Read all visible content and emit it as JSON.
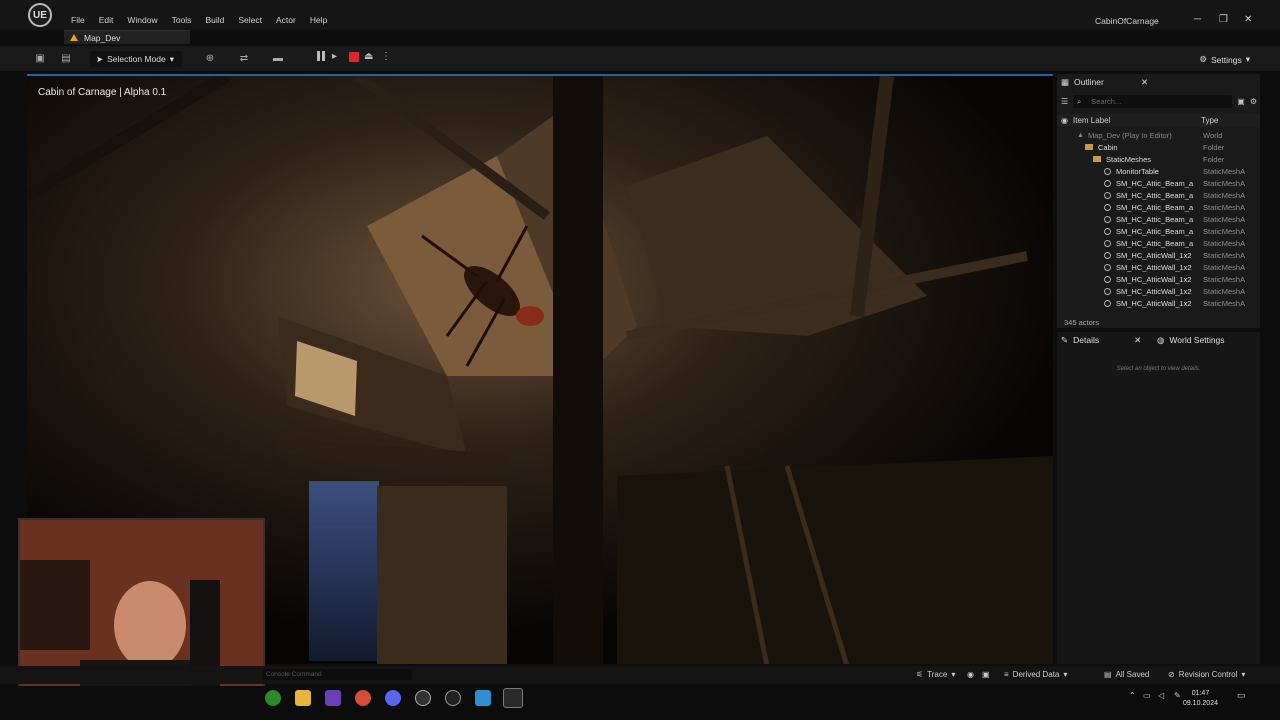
{
  "app": {
    "logo": "UE",
    "menu": [
      "File",
      "Edit",
      "Window",
      "Tools",
      "Build",
      "Select",
      "Actor",
      "Help"
    ],
    "level_tab": "Map_Dev",
    "project_title": "CabinOfCarnage"
  },
  "toolbar": {
    "selection_mode": "Selection Mode",
    "settings": "Settings"
  },
  "viewport": {
    "overlay_text": "Cabin of Carnage | Alpha 0.1"
  },
  "outliner": {
    "tab": "Outliner",
    "search_placeholder": "Search...",
    "col_label": "Item Label",
    "col_type": "Type",
    "rows": [
      {
        "label": "Map_Dev (Play In Editor)",
        "type": "World",
        "kind": "world"
      },
      {
        "label": "Cabin",
        "type": "Folder",
        "kind": "folder"
      },
      {
        "label": "StaticMeshes",
        "type": "Folder",
        "kind": "folder"
      },
      {
        "label": "MonitorTable",
        "type": "StaticMeshA",
        "kind": "mesh"
      },
      {
        "label": "SM_HC_Attic_Beam_a",
        "type": "StaticMeshA",
        "kind": "mesh"
      },
      {
        "label": "SM_HC_Attic_Beam_a",
        "type": "StaticMeshA",
        "kind": "mesh"
      },
      {
        "label": "SM_HC_Attic_Beam_a",
        "type": "StaticMeshA",
        "kind": "mesh"
      },
      {
        "label": "SM_HC_Attic_Beam_a",
        "type": "StaticMeshA",
        "kind": "mesh"
      },
      {
        "label": "SM_HC_Attic_Beam_a",
        "type": "StaticMeshA",
        "kind": "mesh"
      },
      {
        "label": "SM_HC_Attic_Beam_a",
        "type": "StaticMeshA",
        "kind": "mesh"
      },
      {
        "label": "SM_HC_AtticWall_1x2",
        "type": "StaticMeshA",
        "kind": "mesh"
      },
      {
        "label": "SM_HC_AtticWall_1x2",
        "type": "StaticMeshA",
        "kind": "mesh"
      },
      {
        "label": "SM_HC_AtticWall_1x2",
        "type": "StaticMeshA",
        "kind": "mesh"
      },
      {
        "label": "SM_HC_AtticWall_1x2",
        "type": "StaticMeshA",
        "kind": "mesh"
      },
      {
        "label": "SM_HC_AtticWall_1x2",
        "type": "StaticMeshA",
        "kind": "mesh"
      }
    ],
    "actor_count": "345 actors"
  },
  "details": {
    "tab": "Details",
    "tab2": "World Settings",
    "hint": "Select an object to view details."
  },
  "statusbar": {
    "console_placeholder": "Console Command",
    "trace": "Trace",
    "derived_data": "Derived Data",
    "all_saved": "All Saved",
    "revision_control": "Revision Control"
  },
  "taskbar": {
    "time": "01:47",
    "date": "09.10.2024"
  }
}
